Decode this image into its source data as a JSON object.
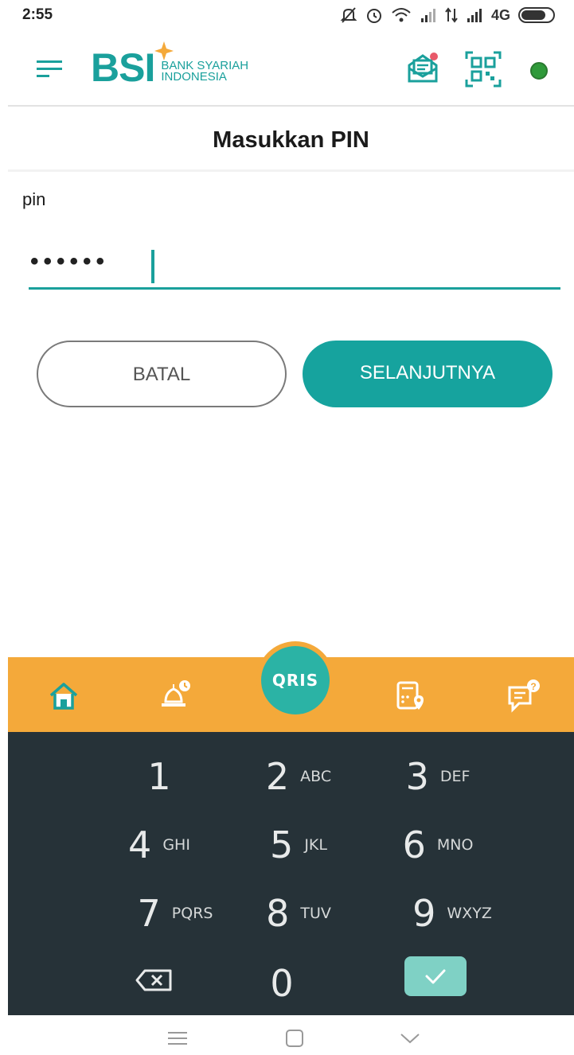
{
  "status_bar": {
    "time": "2:55",
    "network": "4G"
  },
  "header": {
    "logo_main": "BSI",
    "logo_line1": "BANK SYARIAH",
    "logo_line2": "INDONESIA",
    "brand_color": "#1aa09c",
    "status_dot_color": "#2f9a3a"
  },
  "page": {
    "title": "Masukkan PIN"
  },
  "form": {
    "pin_label": "pin",
    "pin_masked_value": "••••••",
    "cancel_label": "BATAL",
    "next_label": "SELANJUTNYA"
  },
  "bottom_nav": {
    "accent": "#f4a93a",
    "items": [
      "home-icon",
      "mosque-icon",
      "qris",
      "atm-location-icon",
      "help-chat-icon"
    ],
    "qris_label": "QRIS"
  },
  "keypad": {
    "keys": [
      {
        "num": "1",
        "letters": ""
      },
      {
        "num": "2",
        "letters": "ABC"
      },
      {
        "num": "3",
        "letters": "DEF"
      },
      {
        "num": "4",
        "letters": "GHI"
      },
      {
        "num": "5",
        "letters": "JKL"
      },
      {
        "num": "6",
        "letters": "MNO"
      },
      {
        "num": "7",
        "letters": "PQRS"
      },
      {
        "num": "8",
        "letters": "TUV"
      },
      {
        "num": "9",
        "letters": "WXYZ"
      },
      {
        "num": "0",
        "letters": ""
      }
    ]
  }
}
